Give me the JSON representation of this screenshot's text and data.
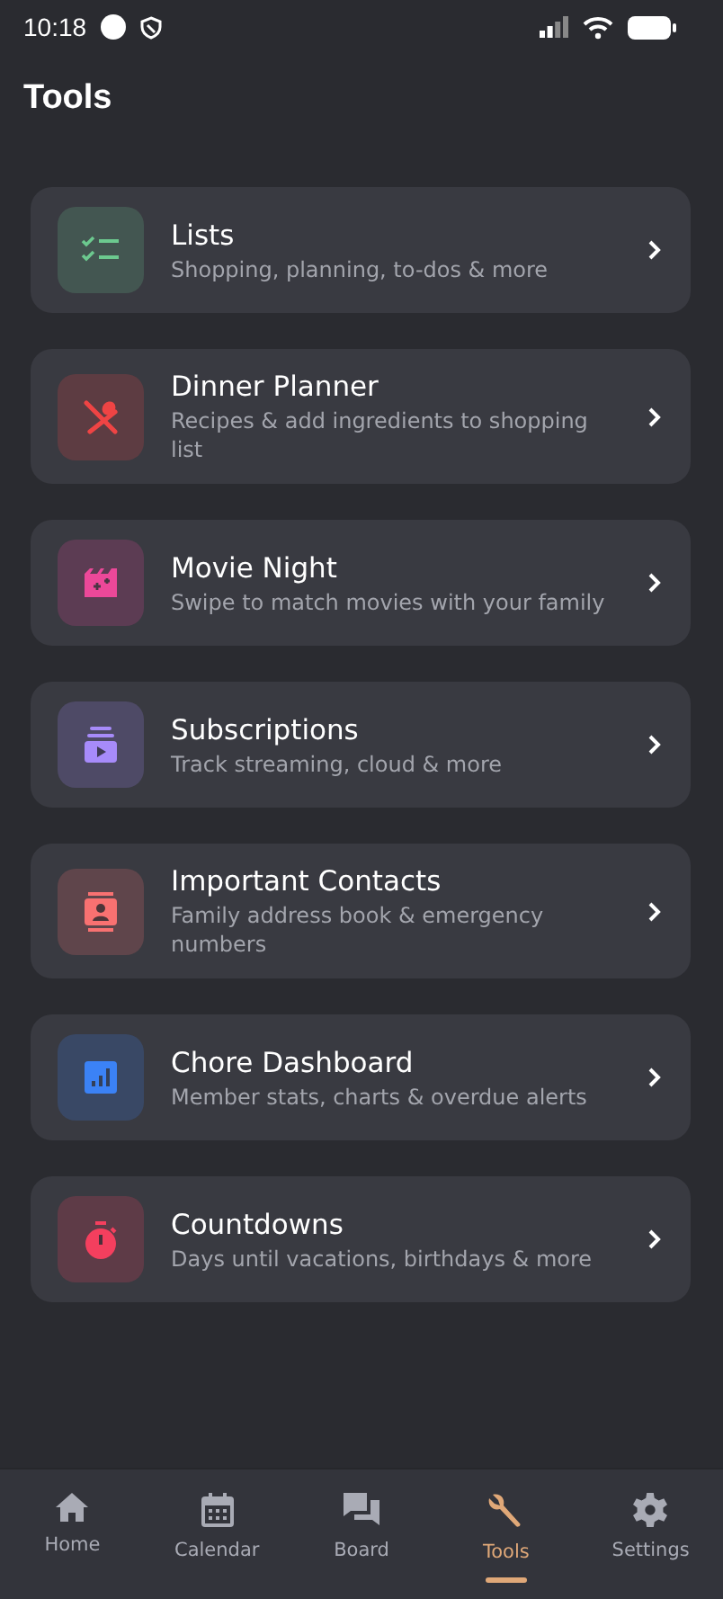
{
  "status_bar": {
    "time": "10:18"
  },
  "title": "Tools",
  "tools": [
    {
      "kind": "checklist",
      "color": "#6cc98f",
      "title": "Lists",
      "subtitle": "Shopping, planning, to-dos & more"
    },
    {
      "kind": "utensils",
      "color": "#ef4444",
      "title": "Dinner Planner",
      "subtitle": "Recipes & add ingredients to shopping list"
    },
    {
      "kind": "clapper",
      "color": "#ec4899",
      "title": "Movie Night",
      "subtitle": "Swipe to match movies with your family"
    },
    {
      "kind": "subscriptions",
      "color": "#a78bfa",
      "title": "Subscriptions",
      "subtitle": "Track streaming, cloud & more"
    },
    {
      "kind": "contact",
      "color": "#f87171",
      "title": "Important Contacts",
      "subtitle": "Family address book & emergency numbers"
    },
    {
      "kind": "chart",
      "color": "#3b82f6",
      "title": "Chore Dashboard",
      "subtitle": "Member stats, charts & overdue alerts"
    },
    {
      "kind": "timer",
      "color": "#f43f5e",
      "title": "Countdowns",
      "subtitle": "Days until vacations, birthdays & more"
    }
  ],
  "nav": [
    {
      "kind": "home",
      "label": "Home",
      "selected": false
    },
    {
      "kind": "calendar",
      "label": "Calendar",
      "selected": false
    },
    {
      "kind": "chat",
      "label": "Board",
      "selected": false
    },
    {
      "kind": "wrench",
      "label": "Tools",
      "selected": true
    },
    {
      "kind": "gear",
      "label": "Settings",
      "selected": false
    }
  ]
}
